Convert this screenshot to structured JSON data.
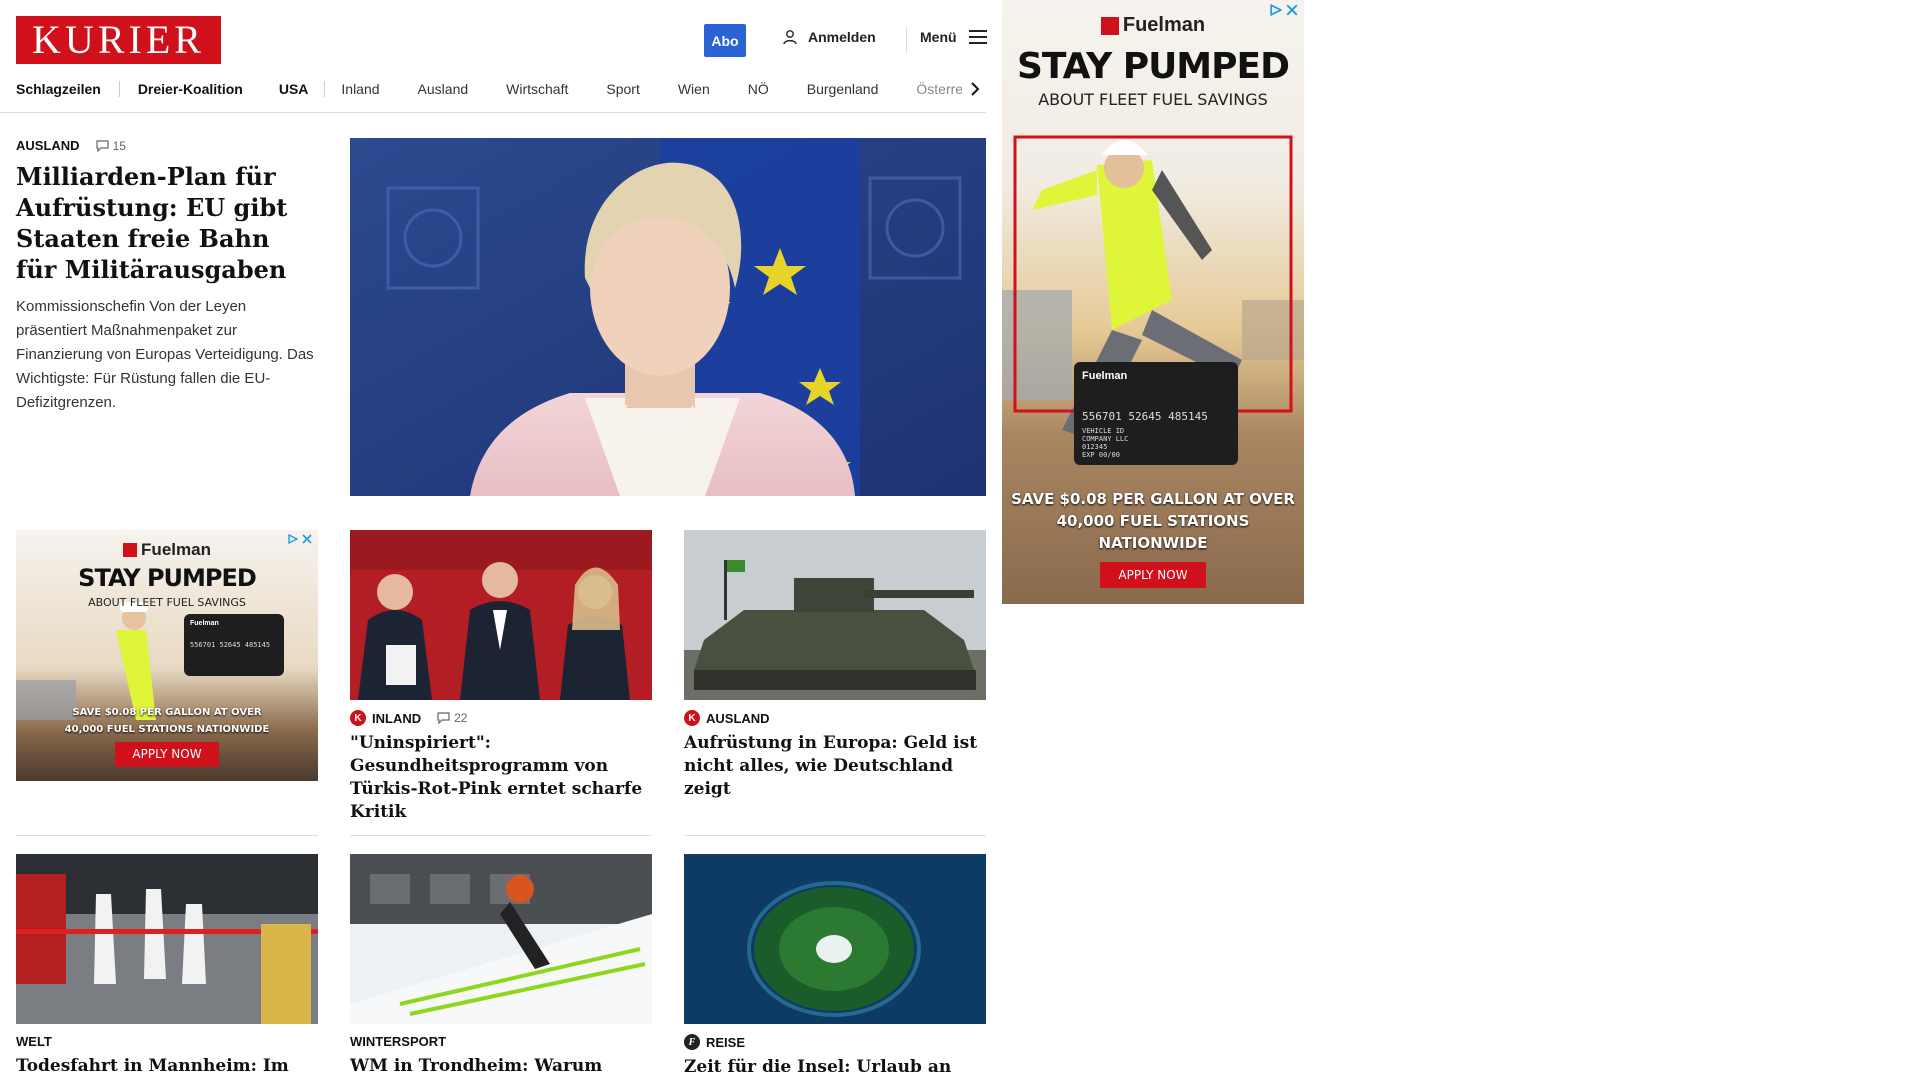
{
  "header": {
    "logo": "KURIER",
    "abo_label": "Abo",
    "login_label": "Anmelden",
    "menu_label": "Menü"
  },
  "nav": {
    "items": [
      {
        "label": "Schlagzeilen"
      },
      {
        "label": "Dreier-Koalition"
      },
      {
        "label": "USA"
      },
      {
        "label": "Inland"
      },
      {
        "label": "Ausland"
      },
      {
        "label": "Wirtschaft"
      },
      {
        "label": "Sport"
      },
      {
        "label": "Wien"
      },
      {
        "label": "NÖ"
      },
      {
        "label": "Burgenland"
      },
      {
        "label": "Österre"
      }
    ]
  },
  "lead": {
    "kicker": "AUSLAND",
    "comments": "15",
    "title": "Milliarden-Plan für Aufrüstung: EU gibt Staaten freie Bahn für Militärausgaben",
    "teaser": "Kommissionschefin Von der Leyen präsentiert Maßnahmenpaket zur Finanzierung von Europas Verteidigung. Das Wichtigste: Für Rüstung fallen die EU-Defizitgrenzen."
  },
  "articles": [
    {
      "kicker": "INLAND",
      "comments": "22",
      "title": "\"Uninspiriert\": Gesundheitsprogramm von Türkis-Rot-Pink erntet scharfe Kritik",
      "badge": "K"
    },
    {
      "kicker": "AUSLAND",
      "comments": "",
      "title": "Aufrüstung in Europa: Geld ist nicht alles, wie Deutschland zeigt",
      "badge": "K"
    },
    {
      "kicker": "WELT",
      "comments": "",
      "title": "Todesfahrt in Mannheim: Im Auto entdeckter Zettel beschäftigt",
      "badge": ""
    },
    {
      "kicker": "WINTERSPORT",
      "comments": "",
      "title": "WM in Trondheim: Warum Skispringer Stefan Kraft",
      "badge": ""
    },
    {
      "kicker": "REISE",
      "comments": "",
      "title": "Zeit für die Insel: Urlaub an den einsamsten Orten der Welt",
      "badge": "f"
    }
  ],
  "ads": {
    "brand": "Fuelman",
    "headline": "STAY PUMPED",
    "sub": "ABOUT FLEET FUEL SAVINGS",
    "saving_line1": "SAVE $0.08 PER GALLON AT OVER",
    "saving_line2": "40,000 FUEL STATIONS NATIONWIDE",
    "cta": "APPLY NOW",
    "card_brand": "Fuelman",
    "card_number": "556701 52645 485145",
    "card_line1": "VEHICLE ID",
    "card_line2": "COMPANY LLC",
    "card_line3": "012345",
    "card_exp": "EXP 00/00"
  },
  "colors": {
    "brand_red": "#d0101b",
    "abo_blue": "#2a63d6"
  }
}
